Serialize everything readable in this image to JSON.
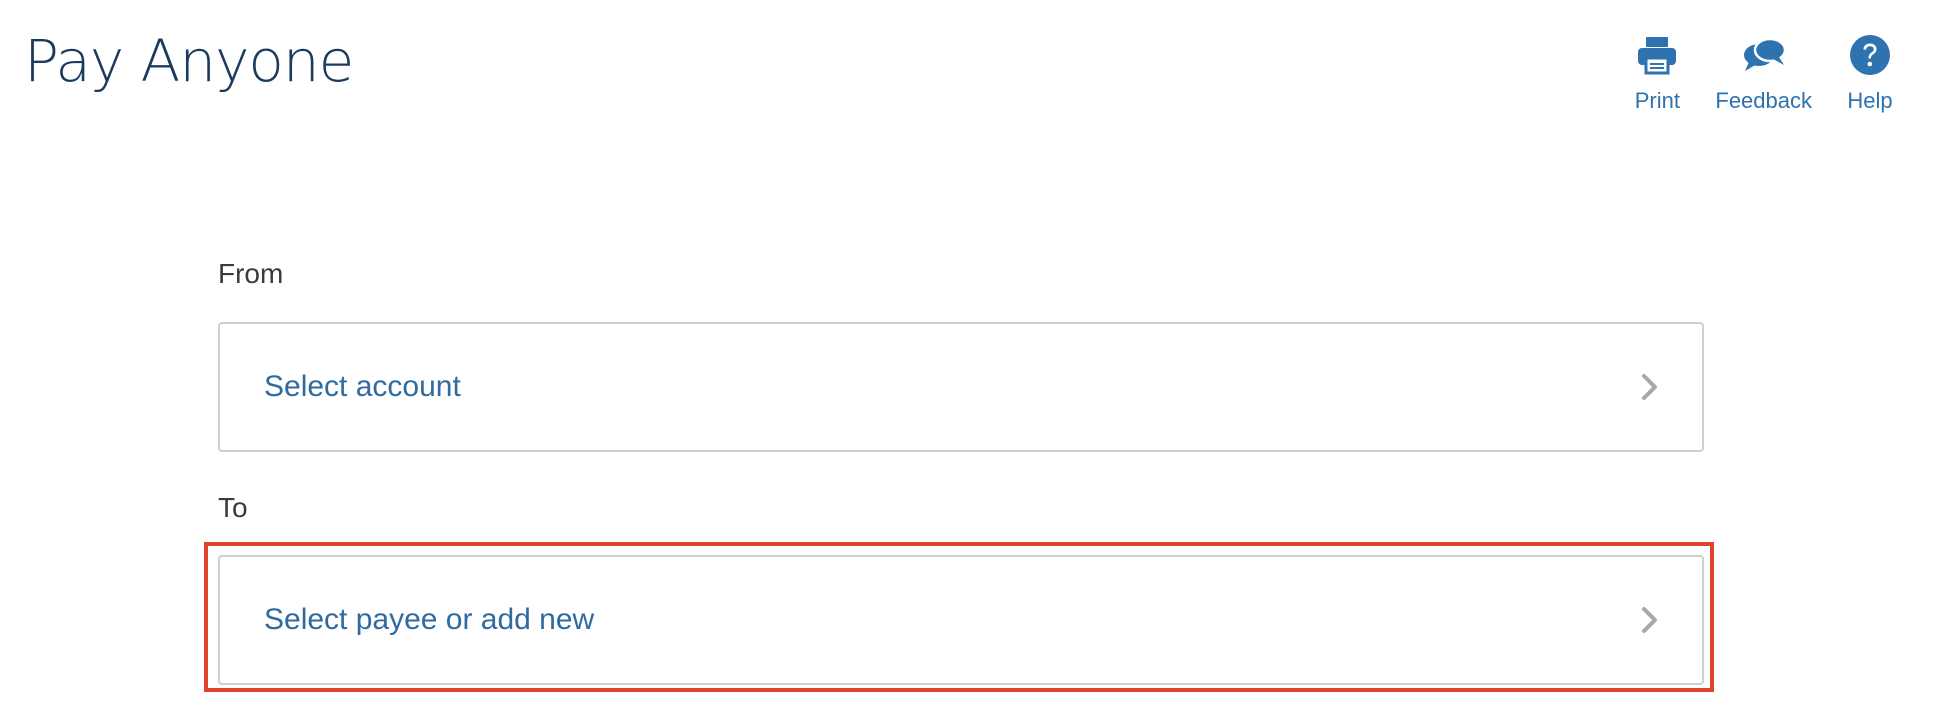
{
  "header": {
    "title": "Pay Anyone"
  },
  "toolbar": {
    "print_label": "Print",
    "feedback_label": "Feedback",
    "help_label": "Help"
  },
  "form": {
    "from": {
      "label": "From",
      "value": "Select account"
    },
    "to": {
      "label": "To",
      "value": "Select payee or add new"
    }
  },
  "icons": {
    "print": "printer-icon",
    "feedback": "speech-bubbles-icon",
    "help": "question-mark-icon",
    "chevron": "chevron-right-icon"
  },
  "colors": {
    "title": "#1b3a5c",
    "accent": "#2f72b0",
    "highlight": "#e0432c",
    "border": "#cfcfcf"
  }
}
